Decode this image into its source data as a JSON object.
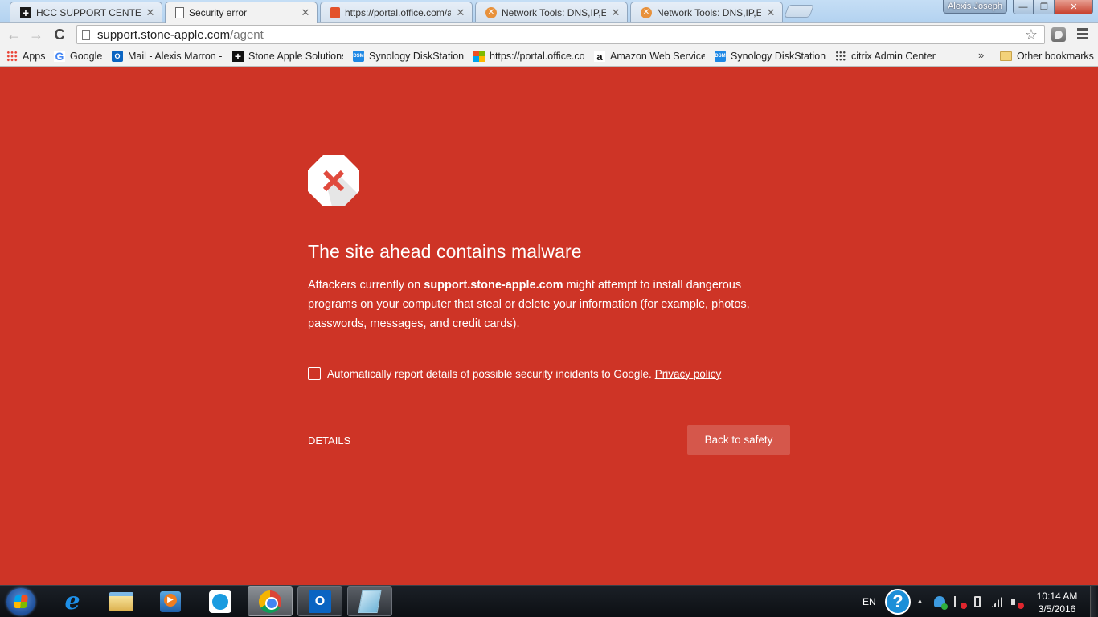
{
  "browser": {
    "tabs": [
      {
        "title": "HCC SUPPORT CENTER",
        "favicon": "plus-icon",
        "active": false
      },
      {
        "title": "Security error",
        "favicon": "page-icon",
        "active": true
      },
      {
        "title": "https://portal.office.com/a",
        "favicon": "office-icon",
        "active": false
      },
      {
        "title": "Network Tools: DNS,IP,Em",
        "favicon": "x-circle-icon",
        "active": false
      },
      {
        "title": "Network Tools: DNS,IP,Em",
        "favicon": "x-circle-icon",
        "active": false
      }
    ],
    "tab_close_glyph": "✕",
    "profile_name": "Alexis Joseph",
    "window_controls": {
      "minimize": "—",
      "restore": "❐",
      "close": "✕"
    },
    "toolbar": {
      "back_glyph": "←",
      "forward_glyph": "→",
      "reload_glyph": "C",
      "url_host": "support.stone-apple.com",
      "url_path": "/agent",
      "star_glyph": "☆"
    },
    "bookmarks": [
      {
        "label": "Apps",
        "icon": "apps-grid-icon",
        "glyph": ""
      },
      {
        "label": "Google",
        "icon": "google-icon",
        "glyph": "G"
      },
      {
        "label": "Mail - Alexis Marron -",
        "icon": "outlook-icon",
        "glyph": "O"
      },
      {
        "label": "Stone Apple Solutions",
        "icon": "plus-icon",
        "glyph": "+"
      },
      {
        "label": "Synology DiskStation",
        "icon": "dsm-icon",
        "glyph": "DSM"
      },
      {
        "label": "https://portal.office.co",
        "icon": "microsoft-icon",
        "glyph": ""
      },
      {
        "label": "Amazon Web Services",
        "icon": "amazon-icon",
        "glyph": "a"
      },
      {
        "label": "Synology DiskStation",
        "icon": "dsm-icon",
        "glyph": "DSM"
      },
      {
        "label": "citrix Admin Center",
        "icon": "citrix-icon",
        "glyph": ""
      }
    ],
    "bookmarks_overflow_glyph": "»",
    "other_bookmarks": "Other bookmarks"
  },
  "interstitial": {
    "background_color": "#ce3426",
    "headline": "The site ahead contains malware",
    "explanation_prefix": "Attackers currently on ",
    "explanation_host": "support.stone-apple.com",
    "explanation_suffix": " might attempt to install dangerous programs on your computer that steal or delete your information (for example, photos, passwords, messages, and credit cards).",
    "report_checkbox_checked": false,
    "report_label": "Automatically report details of possible security incidents to Google.",
    "privacy_link": "Privacy policy",
    "details_link": "DETAILS",
    "primary_button": "Back to safety"
  },
  "taskbar": {
    "pinned": [
      {
        "name": "internet-explorer",
        "glyph": "e"
      },
      {
        "name": "file-explorer",
        "glyph": ""
      },
      {
        "name": "media-player",
        "glyph": ""
      },
      {
        "name": "synergy",
        "glyph": ""
      },
      {
        "name": "chrome",
        "glyph": ""
      },
      {
        "name": "outlook",
        "glyph": "O"
      },
      {
        "name": "notepad",
        "glyph": ""
      }
    ],
    "language": "EN",
    "help_glyph": "?",
    "tray_arrow": "▲",
    "time": "10:14 AM",
    "date": "3/5/2016"
  }
}
